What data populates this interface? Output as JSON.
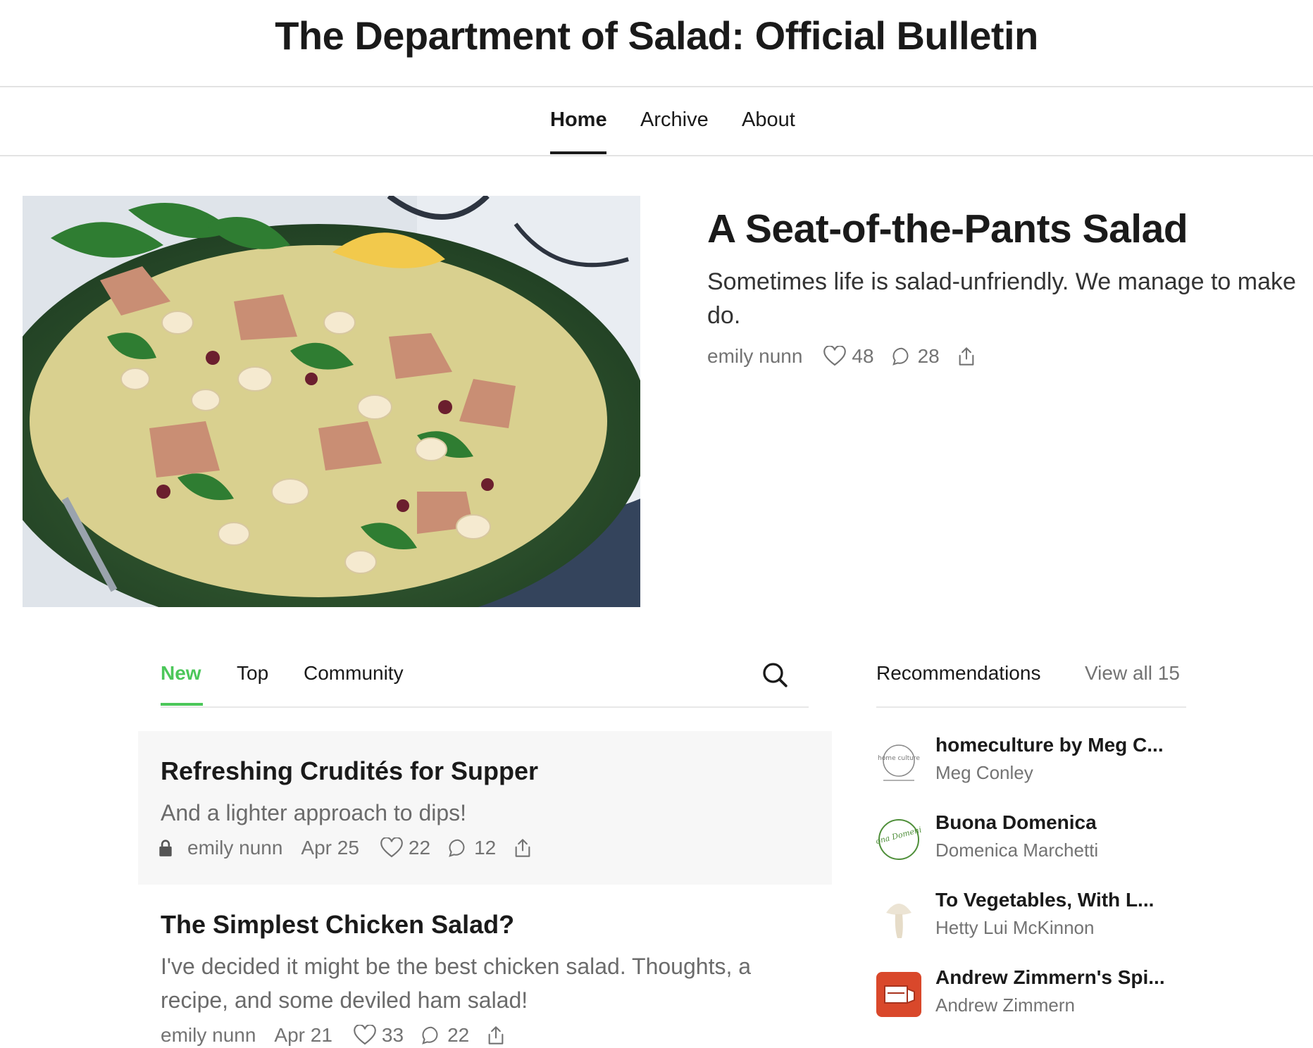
{
  "site": {
    "title": "The Department of Salad: Official Bulletin"
  },
  "nav": {
    "home": "Home",
    "archive": "Archive",
    "about": "About"
  },
  "featured": {
    "title": "A Seat-of-the-Pants Salad",
    "subtitle": "Sometimes life is salad-unfriendly. We manage to make do.",
    "author": "emily nunn",
    "likes": "48",
    "comments": "28"
  },
  "feed_tabs": {
    "new": "New",
    "top": "Top",
    "community": "Community"
  },
  "posts": [
    {
      "title": "Refreshing Crudités for Supper",
      "subtitle": "And a lighter approach to dips!",
      "author": "emily nunn",
      "date": "Apr 25",
      "likes": "22",
      "comments": "12",
      "locked": true
    },
    {
      "title": "The Simplest Chicken Salad?",
      "subtitle": "I've decided it might be the best chicken salad. Thoughts, a recipe, and some deviled ham salad!",
      "author": "emily nunn",
      "date": "Apr 21",
      "likes": "33",
      "comments": "22",
      "locked": false
    }
  ],
  "recommendations": {
    "heading": "Recommendations",
    "view_all": "View all 15",
    "items": [
      {
        "name": "homeculture by Meg C...",
        "author": "Meg Conley",
        "logo_text": "home culture"
      },
      {
        "name": "Buona Domenica",
        "author": "Domenica Marchetti",
        "logo_text": "Buona Domenica"
      },
      {
        "name": "To Vegetables, With L...",
        "author": "Hetty Lui McKinnon"
      },
      {
        "name": "Andrew Zimmern's Spi...",
        "author": "Andrew Zimmern"
      }
    ]
  },
  "colors": {
    "accent": "#4cc75a",
    "text": "#1a1a1a",
    "muted": "#737373",
    "card_bg": "#f7f7f7"
  }
}
